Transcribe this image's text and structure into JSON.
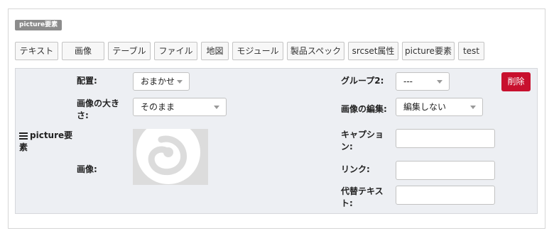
{
  "badge": "picture要素",
  "tabs": [
    {
      "label": "テキスト"
    },
    {
      "label": "画像"
    },
    {
      "label": "テーブル"
    },
    {
      "label": "ファイル"
    },
    {
      "label": "地図"
    },
    {
      "label": "モジュール"
    },
    {
      "label": "製品スペック"
    },
    {
      "label": "srcset属性"
    },
    {
      "label": "picture要素"
    },
    {
      "label": "test"
    }
  ],
  "block": {
    "title_line1": "picture要",
    "title_line2": "素",
    "placement": {
      "label": "配置:",
      "value": "おまかせ"
    },
    "size": {
      "label_line1": "画像の大き",
      "label_line2": "さ:",
      "value": "そのまま"
    },
    "image": {
      "label": "画像:"
    },
    "group": {
      "label": "グループ2:",
      "value": "---"
    },
    "edit": {
      "label": "画像の編集:",
      "value": "編集しない"
    },
    "caption": {
      "label_line1": "キャプショ",
      "label_line2": "ン:",
      "value": ""
    },
    "link": {
      "label": "リンク:",
      "value": ""
    },
    "alt": {
      "label_line1": "代替テキス",
      "label_line2": "ト:",
      "value": ""
    },
    "delete_label": "削除"
  },
  "colors": {
    "delete": "#c8102e",
    "badge": "#8c8c8c",
    "block_bg": "#edeff3"
  }
}
